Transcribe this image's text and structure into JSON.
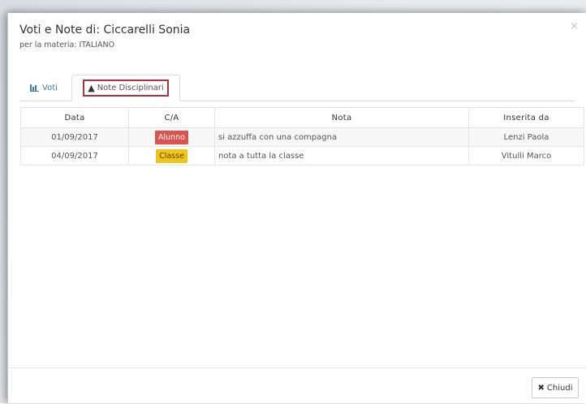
{
  "modal": {
    "title": "Voti e Note di: Ciccarelli Sonia",
    "subtitle": "per la materia: ITALIANO",
    "close_glyph": "×"
  },
  "tabs": [
    {
      "label": "Voti",
      "icon": "bar-chart-icon",
      "active": false
    },
    {
      "label": "Note Disciplinari",
      "icon": "warning-icon",
      "active": true
    }
  ],
  "table": {
    "headers": [
      "Data",
      "C/A",
      "Nota",
      "Inserita da"
    ],
    "rows": [
      {
        "data": "01/09/2017",
        "ca": "Alunno",
        "ca_color": "#d9534f",
        "ca_text_color": "#ffffff",
        "nota": "si azzuffa con una compagna",
        "inserita_da": "Lenzi Paola"
      },
      {
        "data": "04/09/2017",
        "ca": "Classe",
        "ca_color": "#f0c419",
        "ca_text_color": "#5a4a00",
        "nota": "nota a tutta la classe",
        "inserita_da": "Vitulli Marco"
      }
    ]
  },
  "footer": {
    "close_label": "Chiudi",
    "close_icon": "close-icon"
  },
  "colors": {
    "accent": "#3d7fb3",
    "highlight_border": "#b03238"
  }
}
